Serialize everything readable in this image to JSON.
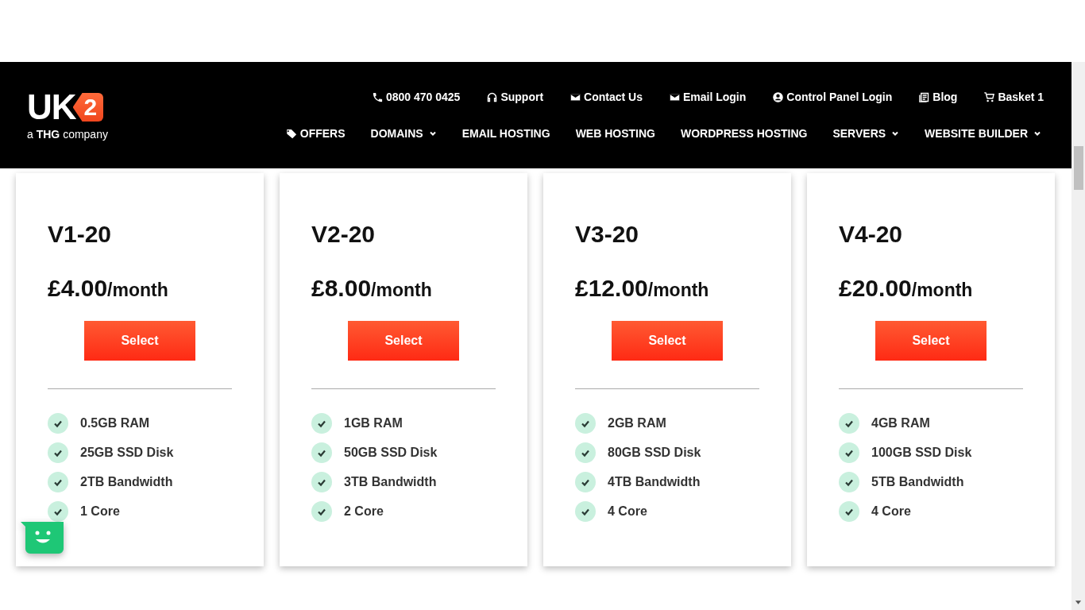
{
  "logo": {
    "mark": "UK",
    "mark_badge": "2",
    "tagline_prefix": "a ",
    "tagline_brand": "THG",
    "tagline_suffix": " company"
  },
  "utility_links": [
    "0800 470 0425",
    "Support",
    "Contact Us",
    "Email Login",
    "Control Panel Login",
    "Blog",
    "Basket 1"
  ],
  "main_nav": [
    {
      "label": "OFFERS",
      "dropdown": false
    },
    {
      "label": "DOMAINS",
      "dropdown": true
    },
    {
      "label": "EMAIL HOSTING",
      "dropdown": false
    },
    {
      "label": "WEB HOSTING",
      "dropdown": false
    },
    {
      "label": "WORDPRESS HOSTING",
      "dropdown": false
    },
    {
      "label": "SERVERS",
      "dropdown": true
    },
    {
      "label": "WEBSITE BUILDER",
      "dropdown": true
    }
  ],
  "plans": [
    {
      "name": "V1-20",
      "price": "£4.00",
      "period": "/month",
      "button": "Select",
      "features": [
        "0.5GB RAM",
        "25GB SSD Disk",
        "2TB Bandwidth",
        "1 Core"
      ]
    },
    {
      "name": "V2-20",
      "price": "£8.00",
      "period": "/month",
      "button": "Select",
      "features": [
        "1GB RAM",
        "50GB SSD Disk",
        "3TB Bandwidth",
        "2 Core"
      ]
    },
    {
      "name": "V3-20",
      "price": "£12.00",
      "period": "/month",
      "button": "Select",
      "features": [
        "2GB RAM",
        "80GB SSD Disk",
        "4TB Bandwidth",
        "4 Core"
      ]
    },
    {
      "name": "V4-20",
      "price": "£20.00",
      "period": "/month",
      "button": "Select",
      "features": [
        "4GB RAM",
        "100GB SSD Disk",
        "5TB Bandwidth",
        "4 Core"
      ]
    }
  ]
}
